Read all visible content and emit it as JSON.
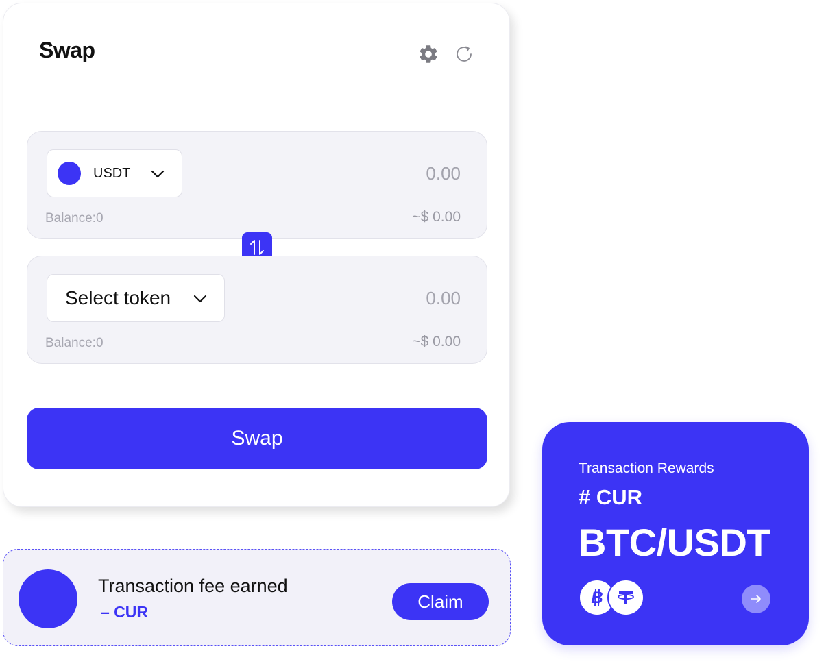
{
  "colors": {
    "accent": "#3c34f5",
    "panel_bg": "#f3f3f8",
    "muted_text": "#a3a3ad",
    "arrow_btn": "#8f8cfb"
  },
  "swap_card": {
    "title": "Swap",
    "icons": {
      "settings": "gear-icon",
      "refresh": "refresh-icon"
    },
    "from": {
      "token": "USDT",
      "amount": "0.00",
      "balance": "Balance:0",
      "usd_value": "~$ 0.00"
    },
    "to": {
      "token": "Select token",
      "amount": "0.00",
      "balance": "Balance:0",
      "usd_value": "~$ 0.00"
    },
    "switch_icon": "swap-arrows-icon",
    "submit_label": "Swap"
  },
  "fee_card": {
    "title": "Transaction fee earned",
    "amount": "– CUR",
    "claim_label": "Claim"
  },
  "rewards_card": {
    "label": "Transaction Rewards",
    "currency": "# CUR",
    "pair": "BTC/USDT",
    "coins": [
      "bitcoin-icon",
      "tether-icon"
    ],
    "arrow_icon": "arrow-right-icon"
  }
}
